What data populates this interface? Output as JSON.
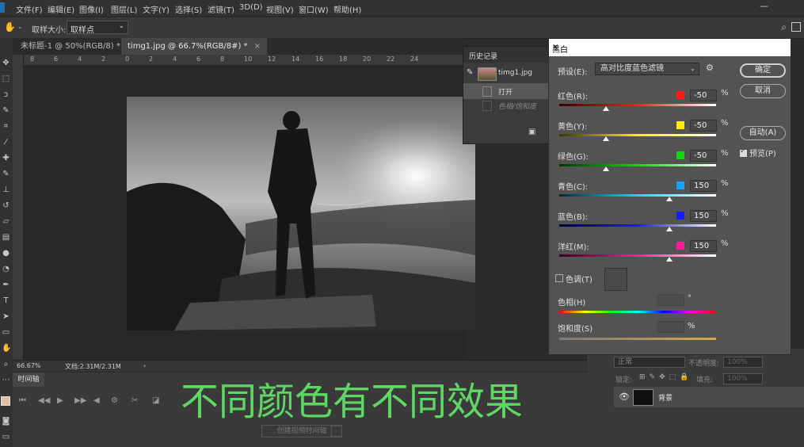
{
  "menu": [
    "文件(F)",
    "编辑(E)",
    "图像(I)",
    "图层(L)",
    "文字(Y)",
    "选择(S)",
    "滤镜(T)",
    "3D(D)",
    "视图(V)",
    "窗口(W)",
    "帮助(H)"
  ],
  "options_bar": {
    "sample_size_label": "取样大小:",
    "sample_size_value": "取样点"
  },
  "tabs": [
    {
      "label": "未标题-1 @ 50%(RGB/8) *",
      "close": "×"
    },
    {
      "label": "timg1.jpg @ 66.7%(RGB/8#) *",
      "close": "×"
    }
  ],
  "ruler_ticks": [
    "8",
    "6",
    "4",
    "2",
    "0",
    "2",
    "4",
    "6",
    "8",
    "10",
    "12",
    "14",
    "16",
    "18",
    "20",
    "22",
    "24"
  ],
  "status": {
    "zoom": "66.67%",
    "doc": "文档:2.31M/2.31M",
    "arrow": "›"
  },
  "timeline": {
    "title": "时间轴",
    "create_button": "创建视频时间轴"
  },
  "history": {
    "title": "历史记录",
    "items": [
      {
        "label": "timg1.jpg",
        "selected": false
      },
      {
        "label": "打开",
        "selected": true
      },
      {
        "label": "色相/饱和度",
        "selected": false
      }
    ]
  },
  "layers": {
    "blend_mode": "正常",
    "opacity_label": "不透明度:",
    "opacity_value": "100%",
    "lock_label": "锁定:",
    "fill_label": "填充:",
    "fill_value": "100%",
    "layer_name": "背景"
  },
  "dialog": {
    "title": "黑白",
    "close": "×",
    "preset_label": "预设(E):",
    "preset_value": "高对比度蓝色滤镜",
    "ok": "确定",
    "cancel": "取消",
    "auto": "自动(A)",
    "preview": "预览(P)",
    "colors": [
      {
        "label": "红色(R):",
        "value": "-50",
        "swatch": "#ff1a1a",
        "gradient": "linear-gradient(90deg,#3a0000,#ff1a1a,#ffffff)",
        "pos": 0.3
      },
      {
        "label": "黄色(Y):",
        "value": "-50",
        "swatch": "#ffee00",
        "gradient": "linear-gradient(90deg,#3a3500,#ffee00,#ffffff)",
        "pos": 0.3
      },
      {
        "label": "绿色(G):",
        "value": "-50",
        "swatch": "#14d414",
        "gradient": "linear-gradient(90deg,#003a00,#14d414,#ffffff)",
        "pos": 0.3
      },
      {
        "label": "青色(C):",
        "value": "150",
        "swatch": "#1aa0ff",
        "gradient": "linear-gradient(90deg,#002a3a,#1ad4ff,#ffffff)",
        "pos": 0.7
      },
      {
        "label": "蓝色(B):",
        "value": "150",
        "swatch": "#1a1aff",
        "gradient": "linear-gradient(90deg,#00003a,#1a1aff,#ffffff)",
        "pos": 0.7
      },
      {
        "label": "洋红(M):",
        "value": "150",
        "swatch": "#ff1a9a",
        "gradient": "linear-gradient(90deg,#3a0020,#ff1a9a,#ffffff)",
        "pos": 0.7
      }
    ],
    "percent": "%",
    "tint_label": "色调(T)",
    "hue_label": "色相(H)",
    "hue_unit": "°",
    "saturation_label": "饱和度(S)",
    "saturation_unit": "%"
  },
  "overlay_text": "不同颜色有不同效果"
}
